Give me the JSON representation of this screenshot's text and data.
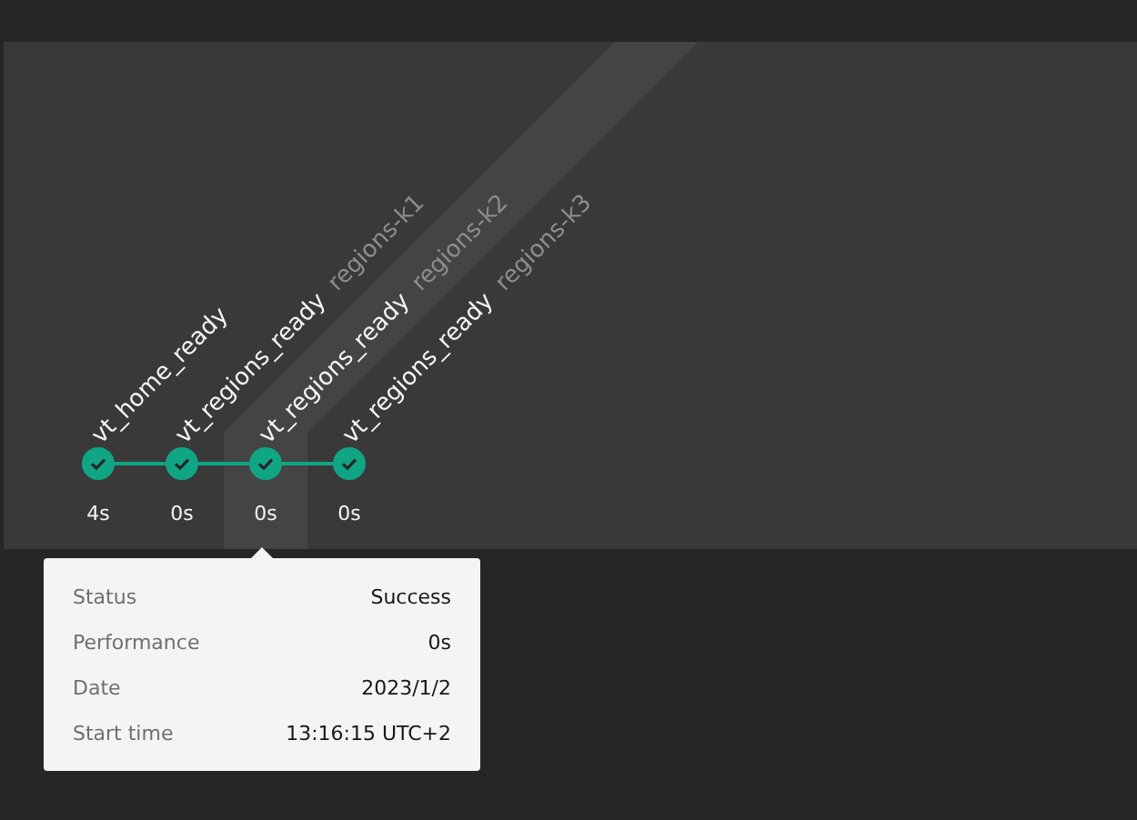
{
  "steps": [
    {
      "name": "vt_home_ready",
      "duration": "4s",
      "selected": false
    },
    {
      "name": "vt_regions_ready",
      "tag": "regions-k1",
      "duration": "0s",
      "selected": false
    },
    {
      "name": "vt_regions_ready",
      "tag": "regions-k2",
      "duration": "0s",
      "selected": true
    },
    {
      "name": "vt_regions_ready",
      "tag": "regions-k3",
      "duration": "0s",
      "selected": false
    }
  ],
  "tooltip": {
    "rows": [
      {
        "label": "Status",
        "value": "Success"
      },
      {
        "label": "Performance",
        "value": "0s"
      },
      {
        "label": "Date",
        "value": "2023/1/2"
      },
      {
        "label": "Start time",
        "value": "13:16:15 UTC+2"
      }
    ]
  }
}
